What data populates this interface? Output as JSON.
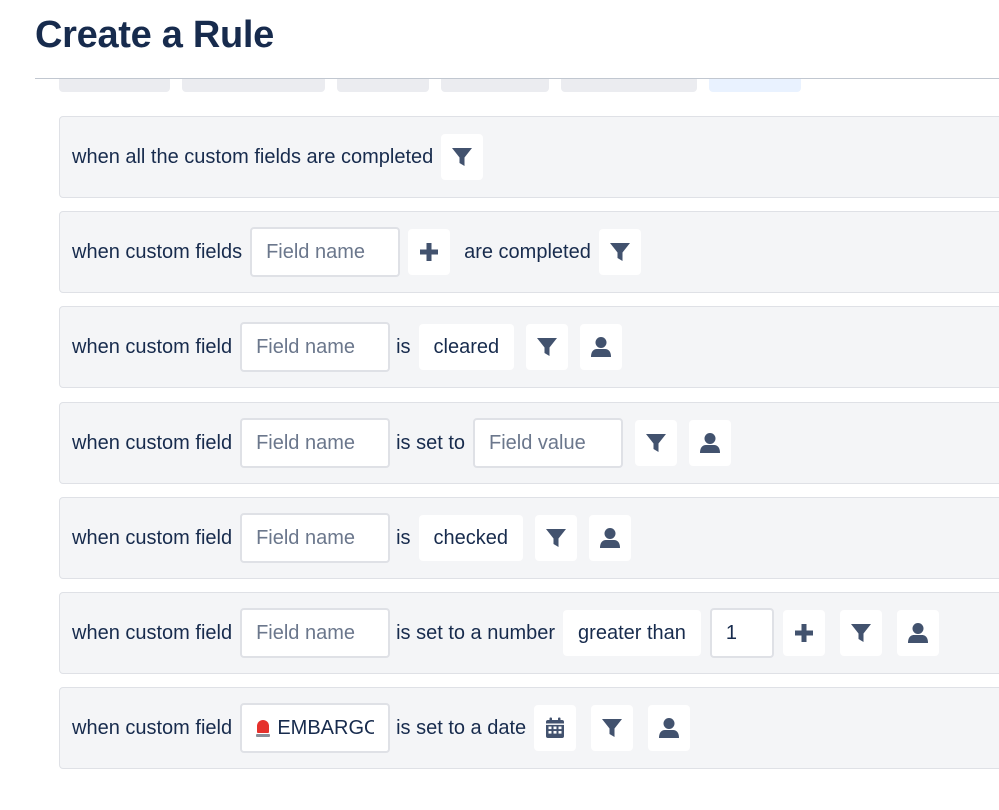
{
  "page": {
    "title": "Create a Rule"
  },
  "rules": [
    {
      "prefix": "when all the custom fields are completed"
    },
    {
      "prefix": "when custom fields",
      "field_placeholder": "Field name",
      "suffix": "are completed"
    },
    {
      "prefix": "when custom field",
      "field_placeholder": "Field name",
      "connector": "is",
      "value": "cleared"
    },
    {
      "prefix": "when custom field",
      "field_placeholder": "Field name",
      "connector": "is set to",
      "value_placeholder": "Field value"
    },
    {
      "prefix": "when custom field",
      "field_placeholder": "Field name",
      "connector": "is",
      "value": "checked"
    },
    {
      "prefix": "when custom field",
      "field_placeholder": "Field name",
      "connector": "is set to a number",
      "comparator": "greater than",
      "number_value": "1"
    },
    {
      "prefix": "when custom field",
      "field_value": "EMBARGO",
      "connector": "is set to a date"
    }
  ],
  "icons": {
    "filter": "filter-icon",
    "user": "user-icon",
    "plus": "plus-icon",
    "calendar": "calendar-icon",
    "siren": "siren-icon"
  },
  "colors": {
    "title": "#172b4d",
    "row_background": "#f4f5f7",
    "icon": "#42526e",
    "placeholder": "#6b778c"
  }
}
